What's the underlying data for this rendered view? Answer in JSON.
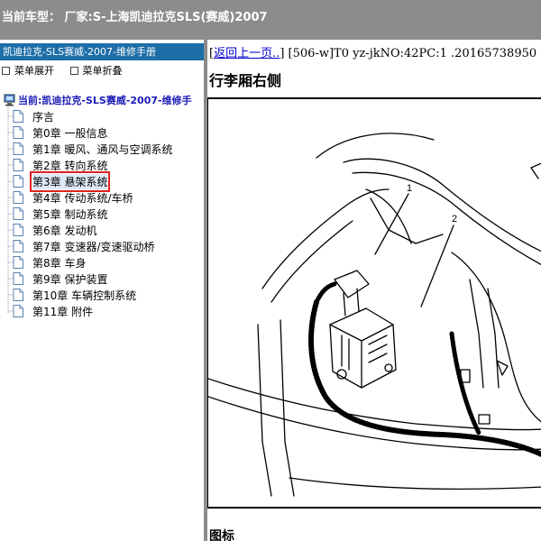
{
  "window": {
    "title": "当前车型： 厂家:S-上海凯迪拉克SLS(赛威)2007"
  },
  "sidebar": {
    "header": "凯迪拉克-SLS赛威-2007-维修手册",
    "ops": [
      {
        "label": "菜单展开"
      },
      {
        "label": "菜单折叠"
      }
    ],
    "root_label": "当前:凯迪拉克-SLS赛威-2007-维修手",
    "items": [
      {
        "label": "序言"
      },
      {
        "label": "第0章 一般信息"
      },
      {
        "label": "第1章 暖风、通风与空调系统"
      },
      {
        "label": "第2章 转向系统"
      },
      {
        "label": "第3章 悬架系统",
        "selected": true
      },
      {
        "label": "第4章 传动系统/车桥"
      },
      {
        "label": "第5章 制动系统"
      },
      {
        "label": "第6章 发动机"
      },
      {
        "label": "第7章 变速器/变速驱动桥"
      },
      {
        "label": "第8章 车身"
      },
      {
        "label": "第9章 保护装置"
      },
      {
        "label": "第10章 车辆控制系统"
      },
      {
        "label": "第11章 附件"
      }
    ]
  },
  "content": {
    "back_link": "返回上一页..",
    "nav_info": " [506-w]T0 yz-jkNO:42PC:1 .20165738950",
    "page_title": "行李厢右侧",
    "callouts": [
      "1",
      "2"
    ],
    "section_title": "图标"
  },
  "colors": {
    "topbar": "#8c8c8c",
    "sidebar_header": "#1e6ea8",
    "selection_outline": "#e02020",
    "link": "#0000cc"
  }
}
